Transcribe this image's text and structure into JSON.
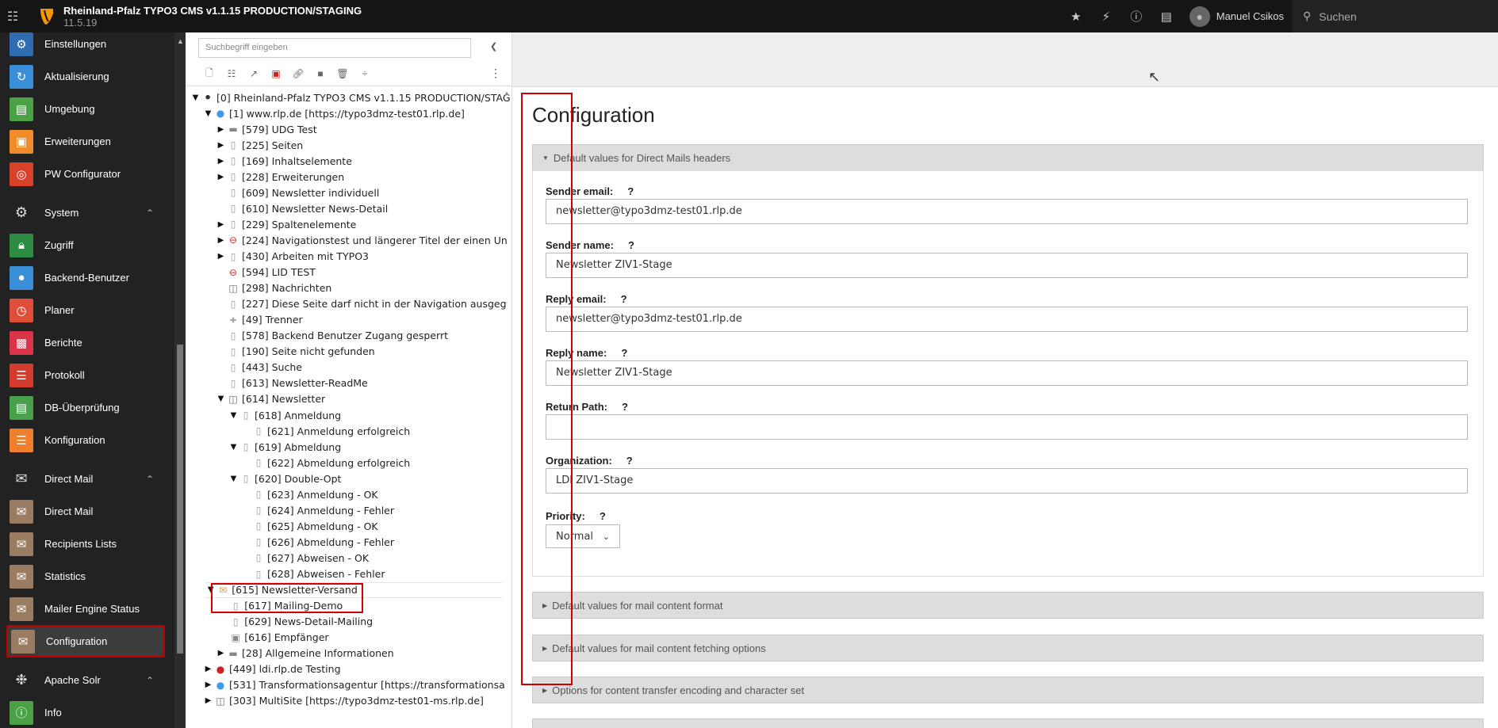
{
  "topbar": {
    "title": "Rheinland-Pfalz TYPO3 CMS v1.1.15 PRODUCTION/STAGING",
    "version": "11.5.19",
    "user": "Manuel Csikos",
    "search_placeholder": "Suchen"
  },
  "modules": {
    "admin": [
      {
        "label": "Einstellungen",
        "icon": "gear-icon",
        "color": "#2f6cb1"
      },
      {
        "label": "Aktualisierung",
        "icon": "refresh-icon",
        "color": "#3b8ed8"
      },
      {
        "label": "Umgebung",
        "icon": "monitor-icon",
        "color": "#4aa146"
      },
      {
        "label": "Erweiterungen",
        "icon": "box-icon",
        "color": "#f08c2a"
      },
      {
        "label": "PW Configurator",
        "icon": "fingerprint-icon",
        "color": "#d9412b"
      }
    ],
    "system_label": "System",
    "system": [
      {
        "label": "Zugriff",
        "icon": "lock-icon",
        "color": "#2e8b43"
      },
      {
        "label": "Backend-Benutzer",
        "icon": "user-icon",
        "color": "#3b8ed8"
      },
      {
        "label": "Planer",
        "icon": "clock-icon",
        "color": "#e04e3a"
      },
      {
        "label": "Berichte",
        "icon": "chart-icon",
        "color": "#d9344a"
      },
      {
        "label": "Protokoll",
        "icon": "log-icon",
        "color": "#d53b2c"
      },
      {
        "label": "DB-Überprüfung",
        "icon": "database-icon",
        "color": "#48a04c"
      },
      {
        "label": "Konfiguration",
        "icon": "sliders-icon",
        "color": "#ef7f2b"
      }
    ],
    "directmail_label": "Direct Mail",
    "directmail": [
      {
        "label": "Direct Mail",
        "icon": "envelope-icon",
        "color": "#9a7c63"
      },
      {
        "label": "Recipients Lists",
        "icon": "list-icon",
        "color": "#9a7c63"
      },
      {
        "label": "Statistics",
        "icon": "stats-icon",
        "color": "#9a7c63"
      },
      {
        "label": "Mailer Engine Status",
        "icon": "engine-icon",
        "color": "#9a7c63"
      },
      {
        "label": "Configuration",
        "icon": "mail-config-icon",
        "color": "#9a7c63"
      }
    ],
    "solr_label": "Apache Solr",
    "solr": [
      {
        "label": "Info",
        "icon": "info-icon",
        "color": "#4aa146"
      }
    ]
  },
  "tree": {
    "search_placeholder": "Suchbegriff eingeben",
    "nodes": [
      {
        "label": "[0] Rheinland-Pfalz TYPO3 CMS v1.1.15 PRODUCTION/STAG",
        "depth": 0,
        "toggle": "open",
        "icon": "typo3-icon"
      },
      {
        "label": "[1] www.rlp.de [https://typo3dmz-test01.rlp.de]",
        "depth": 1,
        "toggle": "open",
        "icon": "globe-icon"
      },
      {
        "label": "[579] UDG Test",
        "depth": 2,
        "toggle": "closed",
        "icon": "folder-icon"
      },
      {
        "label": "[225] Seiten",
        "depth": 2,
        "toggle": "closed",
        "icon": "page-icon"
      },
      {
        "label": "[169] Inhaltselemente",
        "depth": 2,
        "toggle": "closed",
        "icon": "page-icon"
      },
      {
        "label": "[228] Erweiterungen",
        "depth": 2,
        "toggle": "closed",
        "icon": "page-icon"
      },
      {
        "label": "[609] Newsletter individuell",
        "depth": 2,
        "toggle": "",
        "icon": "page-icon"
      },
      {
        "label": "[610] Newsletter News-Detail",
        "depth": 2,
        "toggle": "",
        "icon": "page-icon"
      },
      {
        "label": "[229] Spaltenelemente",
        "depth": 2,
        "toggle": "closed",
        "icon": "page-icon"
      },
      {
        "label": "[224] Navigationstest und längerer Titel der einen Un",
        "depth": 2,
        "toggle": "closed",
        "icon": "restricted-page-icon"
      },
      {
        "label": "[430] Arbeiten mit TYPO3",
        "depth": 2,
        "toggle": "closed",
        "icon": "page-icon"
      },
      {
        "label": "[594] LID TEST",
        "depth": 2,
        "toggle": "",
        "icon": "restricted-page-icon"
      },
      {
        "label": "[298] Nachrichten",
        "depth": 2,
        "toggle": "",
        "icon": "shortcut-page-icon"
      },
      {
        "label": "[227] Diese Seite darf nicht in der Navigation ausgeg",
        "depth": 2,
        "toggle": "",
        "icon": "page-icon"
      },
      {
        "label": "[49] Trenner",
        "depth": 2,
        "toggle": "",
        "icon": "divider-icon"
      },
      {
        "label": "[578] Backend Benutzer Zugang gesperrt",
        "depth": 2,
        "toggle": "",
        "icon": "page-icon"
      },
      {
        "label": "[190] Seite nicht gefunden",
        "depth": 2,
        "toggle": "",
        "icon": "page-icon"
      },
      {
        "label": "[443] Suche",
        "depth": 2,
        "toggle": "",
        "icon": "page-icon"
      },
      {
        "label": "[613] Newsletter-ReadMe",
        "depth": 2,
        "toggle": "",
        "icon": "page-icon"
      },
      {
        "label": "[614] Newsletter",
        "depth": 2,
        "toggle": "open",
        "icon": "shortcut-page-icon"
      },
      {
        "label": "[618] Anmeldung",
        "depth": 3,
        "toggle": "open",
        "icon": "page-icon"
      },
      {
        "label": "[621] Anmeldung erfolgreich",
        "depth": 4,
        "toggle": "",
        "icon": "page-icon"
      },
      {
        "label": "[619] Abmeldung",
        "depth": 3,
        "toggle": "open",
        "icon": "page-icon"
      },
      {
        "label": "[622] Abmeldung erfolgreich",
        "depth": 4,
        "toggle": "",
        "icon": "page-icon"
      },
      {
        "label": "[620] Double-Opt",
        "depth": 3,
        "toggle": "open",
        "icon": "page-icon"
      },
      {
        "label": "[623] Anmeldung - OK",
        "depth": 4,
        "toggle": "",
        "icon": "page-icon"
      },
      {
        "label": "[624] Anmeldung - Fehler",
        "depth": 4,
        "toggle": "",
        "icon": "page-icon"
      },
      {
        "label": "[625] Abmeldung - OK",
        "depth": 4,
        "toggle": "",
        "icon": "page-icon"
      },
      {
        "label": "[626] Abmeldung - Fehler",
        "depth": 4,
        "toggle": "",
        "icon": "page-icon"
      },
      {
        "label": "[627] Abweisen - OK",
        "depth": 4,
        "toggle": "",
        "icon": "page-icon"
      },
      {
        "label": "[628] Abweisen - Fehler",
        "depth": 4,
        "toggle": "",
        "icon": "page-icon"
      },
      {
        "label": "[615] Newsletter-Versand",
        "depth": 1.2,
        "toggle": "open",
        "icon": "mail-folder-icon"
      },
      {
        "label": "[617] Mailing-Demo",
        "depth": 2.2,
        "toggle": "",
        "icon": "page-icon"
      },
      {
        "label": "[629] News-Detail-Mailing",
        "depth": 2.2,
        "toggle": "",
        "icon": "page-icon"
      },
      {
        "label": "[616] Empfänger",
        "depth": 2.2,
        "toggle": "",
        "icon": "recipient-folder-icon"
      },
      {
        "label": "[28] Allgemeine Informationen",
        "depth": 2,
        "toggle": "closed",
        "icon": "folder-icon"
      },
      {
        "label": "[449] ldi.rlp.de Testing",
        "depth": 1,
        "toggle": "closed",
        "icon": "restricted-globe-icon"
      },
      {
        "label": "[531] Transformationsagentur [https://transformationsa",
        "depth": 1,
        "toggle": "closed",
        "icon": "globe-icon"
      },
      {
        "label": "[303] MultiSite [https://typo3dmz-test01-ms.rlp.de]",
        "depth": 1,
        "toggle": "closed",
        "icon": "shortcut-page-icon"
      }
    ]
  },
  "main": {
    "title": "Configuration",
    "panels": [
      "Default values for Direct Mails headers",
      "Default values for mail content format",
      "Default values for mail content fetching options",
      "Options for content transfer encoding and character set"
    ],
    "fields": [
      {
        "label": "Sender email:",
        "value": "newsletter@typo3dmz-test01.rlp.de"
      },
      {
        "label": "Sender name:",
        "value": "Newsletter ZIV1-Stage"
      },
      {
        "label": "Reply email:",
        "value": "newsletter@typo3dmz-test01.rlp.de"
      },
      {
        "label": "Reply name:",
        "value": "Newsletter ZIV1-Stage"
      },
      {
        "label": "Return Path:",
        "value": ""
      },
      {
        "label": "Organization:",
        "value": "LDI ZIV1-Stage"
      }
    ],
    "priority_label": "Priority:",
    "priority_value": "Normal",
    "help_mark": "?"
  }
}
